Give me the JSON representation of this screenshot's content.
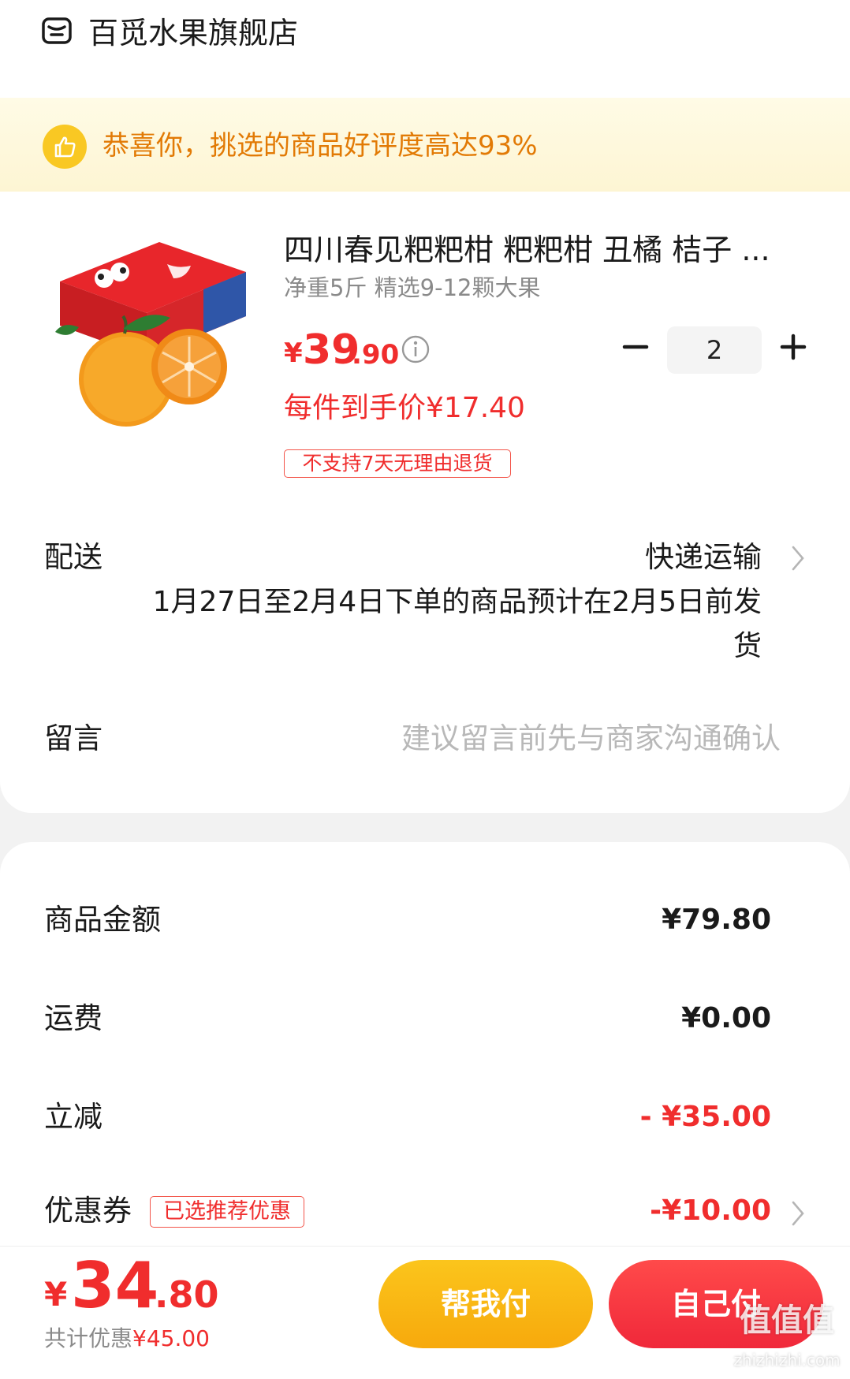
{
  "store": {
    "name": "百觅水果旗舰店",
    "icon": "store-icon"
  },
  "banner": {
    "text": "恭喜你，挑选的商品好评度高达93%",
    "icon": "thumbs-up-icon"
  },
  "product": {
    "title": "四川春见粑粑柑 粑粑柑 丑橘 桔子 ...",
    "spec": "净重5斤 精选9-12颗大果",
    "price_symbol": "¥",
    "price_int": "39",
    "price_dec": ".90",
    "quantity": "2",
    "per_price": "每件到手价¥17.40",
    "return_tag": "不支持7天无理由退货"
  },
  "shipping": {
    "label": "配送",
    "method": "快递运输",
    "note": "1月27日至2月4日下单的商品预计在2月5日前发货"
  },
  "message": {
    "label": "留言",
    "placeholder": "建议留言前先与商家沟通确认"
  },
  "summary": {
    "goods_label": "商品金额",
    "goods_value": "¥79.80",
    "freight_label": "运费",
    "freight_value": "¥0.00",
    "discount_label": "立减",
    "discount_value": "- ¥35.00",
    "coupon_label": "优惠券",
    "coupon_tag": "已选推荐优惠",
    "coupon_value": "-¥10.00"
  },
  "footer": {
    "total_symbol": "¥",
    "total_int": "34",
    "total_dec": ".80",
    "save_label": "共计优惠",
    "save_value": "¥45.00",
    "help_pay_label": "帮我付",
    "self_pay_label": "自己付"
  },
  "watermark": {
    "text": "值值值",
    "url": "zhizhizhi.com"
  },
  "colors": {
    "accent_red": "#f02d2d",
    "accent_yellow": "#f9c823",
    "banner_text": "#e27a05"
  }
}
